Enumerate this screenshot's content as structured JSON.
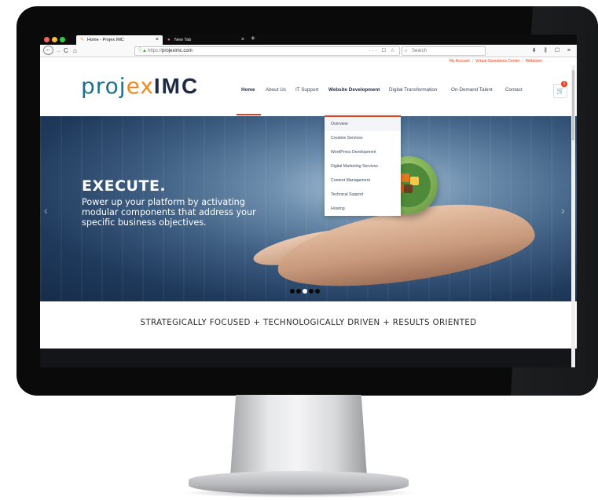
{
  "browser": {
    "tabs": [
      {
        "title": "Home - Projex IMC",
        "close": "×"
      },
      {
        "title": "New Tab",
        "close": "×"
      }
    ],
    "new_tab": "+",
    "nav": {
      "back": "←",
      "forward": "→",
      "reload": "C",
      "home": "⌂"
    },
    "url_protocol": "https://",
    "url_host": "projeximc.com",
    "url_actions": "··· ☐ ☆",
    "search_placeholder": "Search",
    "toolbar_right": "⬇ ⫼ ☐ ≡"
  },
  "utility_links": [
    "My Account",
    "Virtual Operations Center",
    "Webstore"
  ],
  "logo": {
    "part1": "proj",
    "part2": "ex",
    "part3": "IMC"
  },
  "menu": [
    {
      "label": "Home"
    },
    {
      "label": "About Us"
    },
    {
      "label": "IT Support"
    },
    {
      "label": "Website Development"
    },
    {
      "label": "Digital Transformation"
    },
    {
      "label": "On-Demand Talent"
    },
    {
      "label": "Contact"
    }
  ],
  "cart": {
    "count": "2"
  },
  "dropdown": [
    "Overview",
    "Creative Services",
    "WordPress Development",
    "Digital Marketing Services",
    "Content Management",
    "Technical Support",
    "Hosting"
  ],
  "hero": {
    "heading": "EXECUTE.",
    "text": "Power up your platform by activating modular components that address your specific business objectives.",
    "prev": "‹",
    "next": "›",
    "slides": 5,
    "active_slide": 3
  },
  "tagline": "STRATEGICALLY FOCUSED + TECHNOLOGICALLY DRIVEN + RESULTS ORIENTED",
  "colors": {
    "accent": "#e2451e",
    "logo_teal": "#1d6f8c",
    "logo_orange": "#f08a1c",
    "logo_navy": "#1f2a44"
  }
}
